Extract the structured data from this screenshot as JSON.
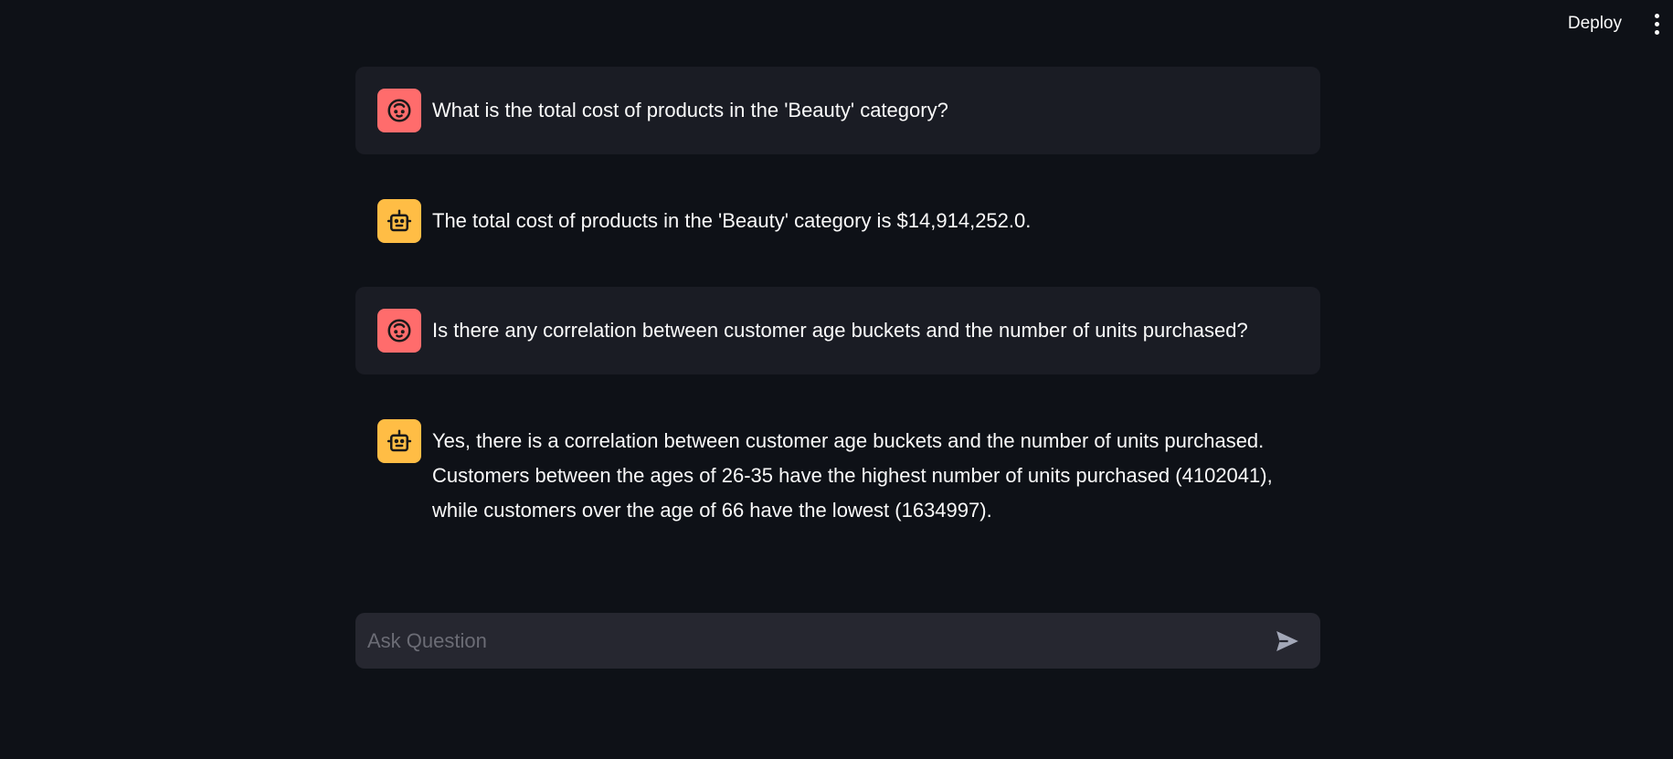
{
  "header": {
    "deploy_label": "Deploy",
    "menu_icon": "vertical-ellipsis-icon"
  },
  "messages": [
    {
      "role": "user",
      "avatar_icon": "user-face-icon",
      "text": "What is the total cost of products in the 'Beauty' category?"
    },
    {
      "role": "assistant",
      "avatar_icon": "robot-icon",
      "text": "The total cost of products in the 'Beauty' category is $14,914,252.0."
    },
    {
      "role": "user",
      "avatar_icon": "user-face-icon",
      "text": "Is there any correlation between customer age buckets and the number of units purchased?"
    },
    {
      "role": "assistant",
      "avatar_icon": "robot-icon",
      "text": "Yes, there is a correlation between customer age buckets and the number of units purchased.\nCustomers between the ages of 26-35 have the highest number of units purchased (4102041),\nwhile customers over the age of 66 have the lowest (1634997)."
    }
  ],
  "chat_input": {
    "placeholder": "Ask Question",
    "value": "",
    "send_icon": "send-arrow-icon"
  },
  "colors": {
    "background": "#0e1117",
    "user_message_bg": "#1a1c24",
    "user_avatar": "#ff6c6c",
    "assistant_avatar": "#ffbd45",
    "input_bg": "#262730",
    "text": "#fafafa",
    "placeholder": "#6b6c75"
  }
}
